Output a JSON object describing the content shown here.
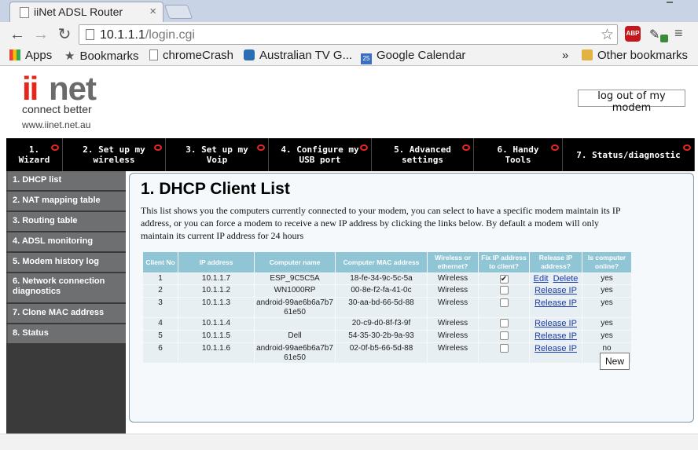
{
  "browser": {
    "tab_title": "iiNet ADSL Router",
    "url_host": "10.1.1.1",
    "url_path": "/login.cgi",
    "bookmarks": [
      "Apps",
      "Bookmarks",
      "chromeCrash",
      "Australian TV G...",
      "Google Calendar"
    ],
    "overflow": "»",
    "other_bookmarks": "Other bookmarks",
    "abp_label": "ABP",
    "calendar_day": "25"
  },
  "header": {
    "logo_ii": "ii",
    "logo_net": "net",
    "tagline": "connect better",
    "site_url": "www.iinet.net.au",
    "logout_label": "log out of my modem"
  },
  "mainnav": [
    {
      "line1": "1.",
      "line2": "Wizard"
    },
    {
      "line1": "2. Set up my",
      "line2": "wireless"
    },
    {
      "line1": "3. Set up my Voip",
      "line2": ""
    },
    {
      "line1": "4. Configure my",
      "line2": "USB port"
    },
    {
      "line1": "5. Advanced",
      "line2": "settings"
    },
    {
      "line1": "6. Handy Tools",
      "line2": ""
    },
    {
      "line1": "7. Status/diagnostic",
      "line2": ""
    }
  ],
  "sidebar": [
    {
      "label": "1. DHCP list"
    },
    {
      "label": "2. NAT mapping table"
    },
    {
      "label": "3. Routing table"
    },
    {
      "label": "4. ADSL monitoring"
    },
    {
      "label": "5. Modem history log"
    },
    {
      "label": "6. Network connection diagnostics"
    },
    {
      "label": "7. Clone MAC address"
    },
    {
      "label": "8. Status"
    }
  ],
  "main": {
    "title": "1. DHCP Client List",
    "description": "This list shows you the computers currently connected to your modem, you can select to have a specific modem maintain its IP address, or you can force a modem to receive a new IP address by clicking the links below. By default a modem will only maintain its current IP address for 24 hours",
    "columns": [
      "Client No",
      "IP address",
      "Computer name",
      "Computer MAC address",
      "Wireless or ethernet?",
      "Fix IP address to client?",
      "Release IP address?",
      "Is computer online?"
    ],
    "rows": [
      {
        "no": "1",
        "ip": "10.1.1.7",
        "name": "ESP_9C5C5A",
        "mac": "18-fe-34-9c-5c-5a",
        "type": "Wireless",
        "fixed": true,
        "action1": "Edit",
        "action2": "Delete",
        "online": "yes"
      },
      {
        "no": "2",
        "ip": "10.1.1.2",
        "name": "WN1000RP",
        "mac": "00-8e-f2-fa-41-0c",
        "type": "Wireless",
        "fixed": false,
        "action1": "Release IP",
        "action2": "",
        "online": "yes"
      },
      {
        "no": "3",
        "ip": "10.1.1.3",
        "name": "android-99ae6b6a7b761e50",
        "mac": "30-aa-bd-66-5d-88",
        "type": "Wireless",
        "fixed": false,
        "action1": "Release IP",
        "action2": "",
        "online": "yes"
      },
      {
        "no": "4",
        "ip": "10.1.1.4",
        "name": "",
        "mac": "20-c9-d0-8f-f3-9f",
        "type": "Wireless",
        "fixed": false,
        "action1": "Release IP",
        "action2": "",
        "online": "yes"
      },
      {
        "no": "5",
        "ip": "10.1.1.5",
        "name": "Dell",
        "mac": "54-35-30-2b-9a-93",
        "type": "Wireless",
        "fixed": false,
        "action1": "Release IP",
        "action2": "",
        "online": "yes"
      },
      {
        "no": "6",
        "ip": "10.1.1.6",
        "name": "android-99ae6b6a7b761e50",
        "mac": "02-0f-b5-66-5d-88",
        "type": "Wireless",
        "fixed": false,
        "action1": "Release IP",
        "action2": "",
        "online": "no"
      }
    ],
    "new_label": "New"
  },
  "colors": {
    "brand_red": "#e4261b",
    "table_header": "#8fc5d4",
    "sidebar_item": "#6d6f70"
  }
}
